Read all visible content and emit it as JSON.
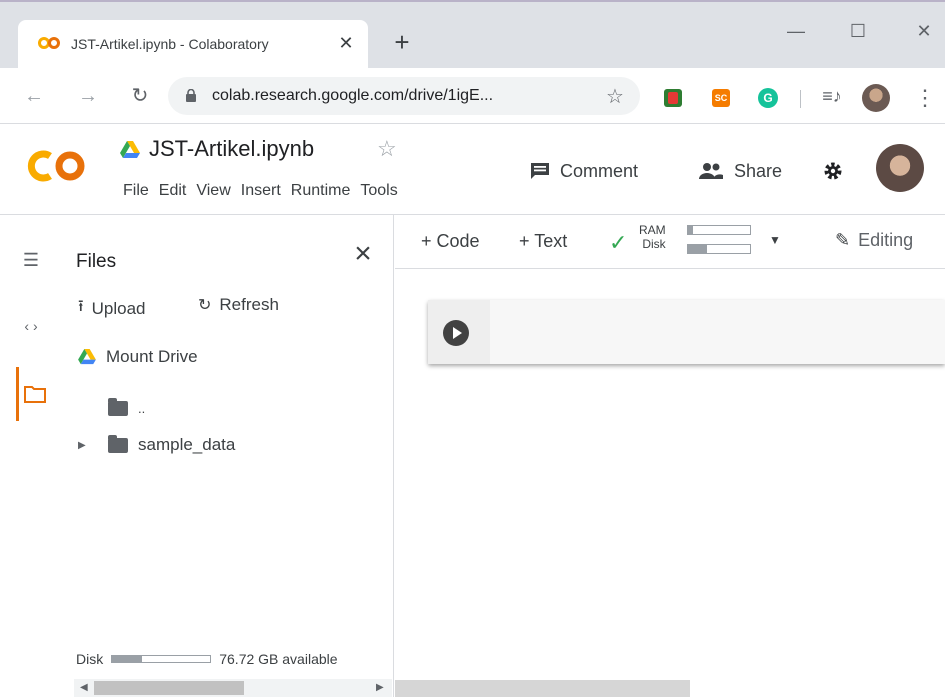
{
  "browser": {
    "tab_title": "JST-Artikel.ipynb - Colaboratory",
    "tab_close": "✕",
    "new_tab": "+",
    "window_minimize": "—",
    "window_maximize": "☐",
    "window_close": "✕",
    "url": "colab.research.google.com/drive/1igE...",
    "extensions": [
      {
        "name": "red-extension",
        "color": "#2e7d32",
        "label": ""
      },
      {
        "name": "sc-extension",
        "color": "#f57c00",
        "label": "SC"
      },
      {
        "name": "grammarly-extension",
        "color": "#15c39a",
        "label": "G"
      }
    ]
  },
  "colab": {
    "logo_text": "CO",
    "notebook_title": "JST-Artikel.ipynb",
    "menu": [
      "File",
      "Edit",
      "View",
      "Insert",
      "Runtime",
      "Tools"
    ],
    "comment_label": "Comment",
    "share_label": "Share"
  },
  "files_panel": {
    "title": "Files",
    "upload_label": "Upload",
    "refresh_label": "Refresh",
    "mount_label": "Mount Drive",
    "parent_dir_label": "..",
    "folder_label": "sample_data",
    "disk_label": "Disk",
    "disk_available": "76.72 GB available",
    "disk_used_fraction": 0.3
  },
  "toolbar": {
    "add_code_label": "+ Code",
    "add_text_label": "+ Text",
    "ram_label": "RAM",
    "disk_label": "Disk",
    "ram_used_fraction": 0.08,
    "disk_used_fraction": 0.3,
    "editing_label": "Editing"
  },
  "colors": {
    "accent": "#e8710a",
    "connected": "#34a853"
  }
}
